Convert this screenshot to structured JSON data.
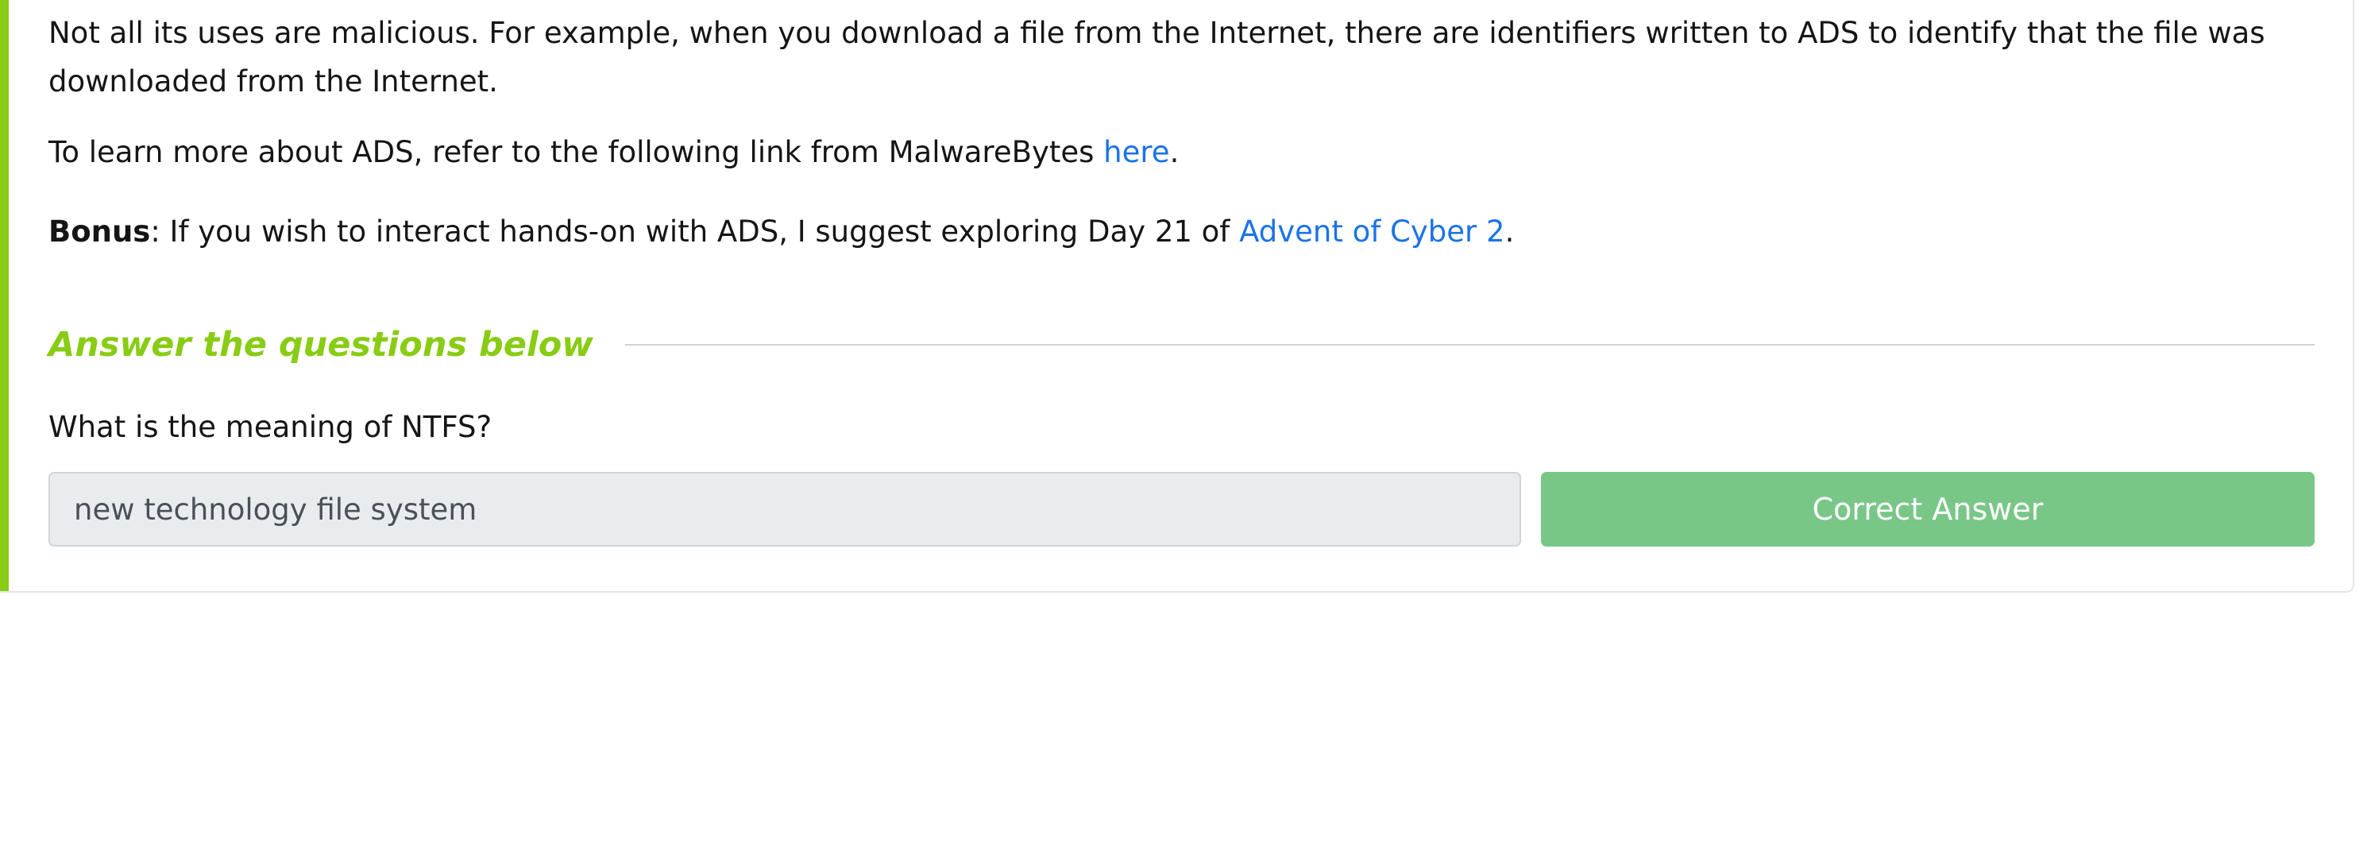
{
  "content": {
    "paragraph1": "Not all its uses are malicious. For example, when you download a file from the Internet, there are identifiers written to ADS to identify that the file was downloaded from the Internet.",
    "paragraph2_prefix": "To learn more about ADS, refer to the following link from MalwareBytes ",
    "paragraph2_link": "here",
    "paragraph2_suffix": ".",
    "paragraph3_bold": "Bonus",
    "paragraph3_text": ": If you wish to interact hands-on with ADS, I suggest exploring Day 21 of ",
    "paragraph3_link": "Advent of Cyber 2",
    "paragraph3_suffix": "."
  },
  "questions": {
    "heading": "Answer the questions below",
    "question1": {
      "text": "What is the meaning of NTFS?",
      "answer_value": "new technology file system",
      "button_label": "Correct Answer"
    }
  },
  "colors": {
    "accent": "#88cc14",
    "link": "#1a73e8",
    "correct_button": "#78c787",
    "input_background": "#e9ecef"
  }
}
